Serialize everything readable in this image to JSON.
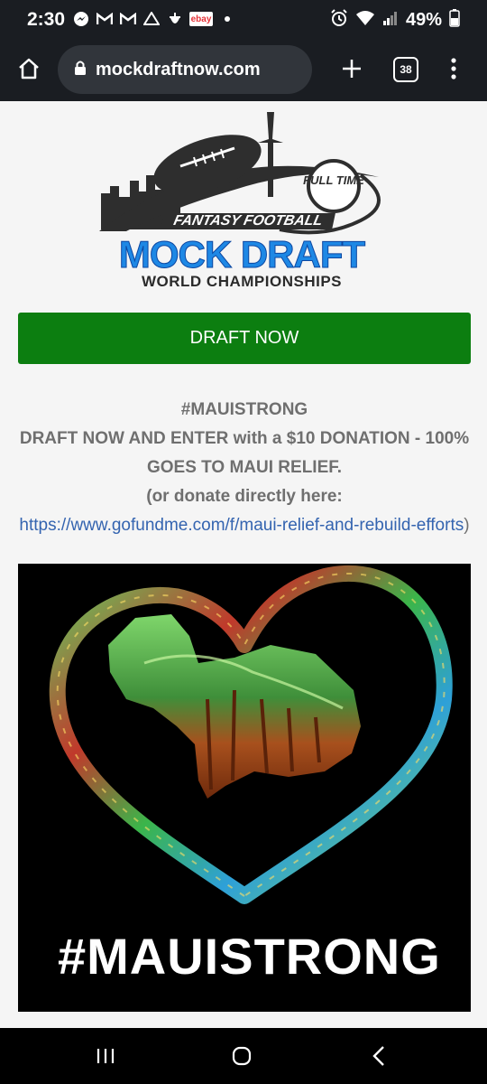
{
  "status_bar": {
    "time": "2:30",
    "battery": "49%",
    "ebay_label": "ebay",
    "left_icons": [
      "messenger-icon",
      "gmail-icon",
      "gmail-icon",
      "drive-icon",
      "acorn-icon",
      "ebay-icon",
      "dot-icon"
    ],
    "right_icons": [
      "alarm-icon",
      "wifi-icon",
      "signal-icon",
      "battery-icon"
    ]
  },
  "browser": {
    "url": "mockdraftnow.com",
    "tab_count": "38"
  },
  "logo": {
    "line1": "FANTASY FOOTBALL",
    "line2": "MOCK DRAFT",
    "line3": "WORLD CHAMPIONSHIPS",
    "badge": "FULL TIME"
  },
  "draft_button": "DRAFT NOW",
  "donation": {
    "hashtag": "#MAUISTRONG",
    "line1": "DRAFT NOW AND ENTER with a $10 DONATION - 100% GOES TO MAUI RELIEF.",
    "line2": "(or donate directly here:",
    "link": "https://www.gofundme.com/f/maui-relief-and-rebuild-efforts",
    "close": ")"
  },
  "banner": {
    "hashtag": "#MAUISTRONG"
  },
  "colors": {
    "chrome": "#1a1d22",
    "draft_button": "#0c7e10",
    "link": "#3464b0",
    "logo_blue": "#1e88e5"
  }
}
